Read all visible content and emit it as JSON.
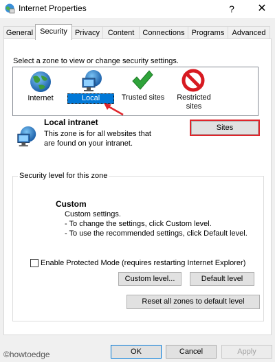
{
  "window": {
    "title": "Internet Properties",
    "help_glyph": "?",
    "close_glyph": "✕"
  },
  "tabs": [
    "General",
    "Security",
    "Privacy",
    "Content",
    "Connections",
    "Programs",
    "Advanced"
  ],
  "active_tab": "Security",
  "zones": {
    "prompt": "Select a zone to view or change security settings.",
    "items": [
      {
        "label": "Internet",
        "icon": "globe-icon"
      },
      {
        "label": "Local intranet",
        "icon": "intranet-icon"
      },
      {
        "label": "Trusted sites",
        "icon": "checkmark-icon"
      },
      {
        "label": "Restricted sites",
        "icon": "restricted-icon"
      }
    ],
    "selected": "Local intranet"
  },
  "selected_zone": {
    "name": "Local intranet",
    "description": "This zone is for all websites that are found on your intranet."
  },
  "sites_button": "Sites",
  "security_level": {
    "legend": "Security level for this zone",
    "level_title": "Custom",
    "lines": [
      "Custom settings.",
      "- To change the settings, click Custom level.",
      "- To use the recommended settings, click Default level."
    ],
    "protected_mode_label": "Enable Protected Mode (requires restarting Internet Explorer)",
    "protected_mode_checked": false,
    "custom_level_button": "Custom level...",
    "default_level_button": "Default level"
  },
  "reset_button": "Reset all zones to default level",
  "dialog_buttons": {
    "ok": "OK",
    "cancel": "Cancel",
    "apply": "Apply"
  },
  "watermark": "©howtoedge",
  "colors": {
    "highlight": "#0078d7",
    "annotation": "#e0252b",
    "check_green": "#2fa33a",
    "restricted_red": "#d71a21"
  }
}
